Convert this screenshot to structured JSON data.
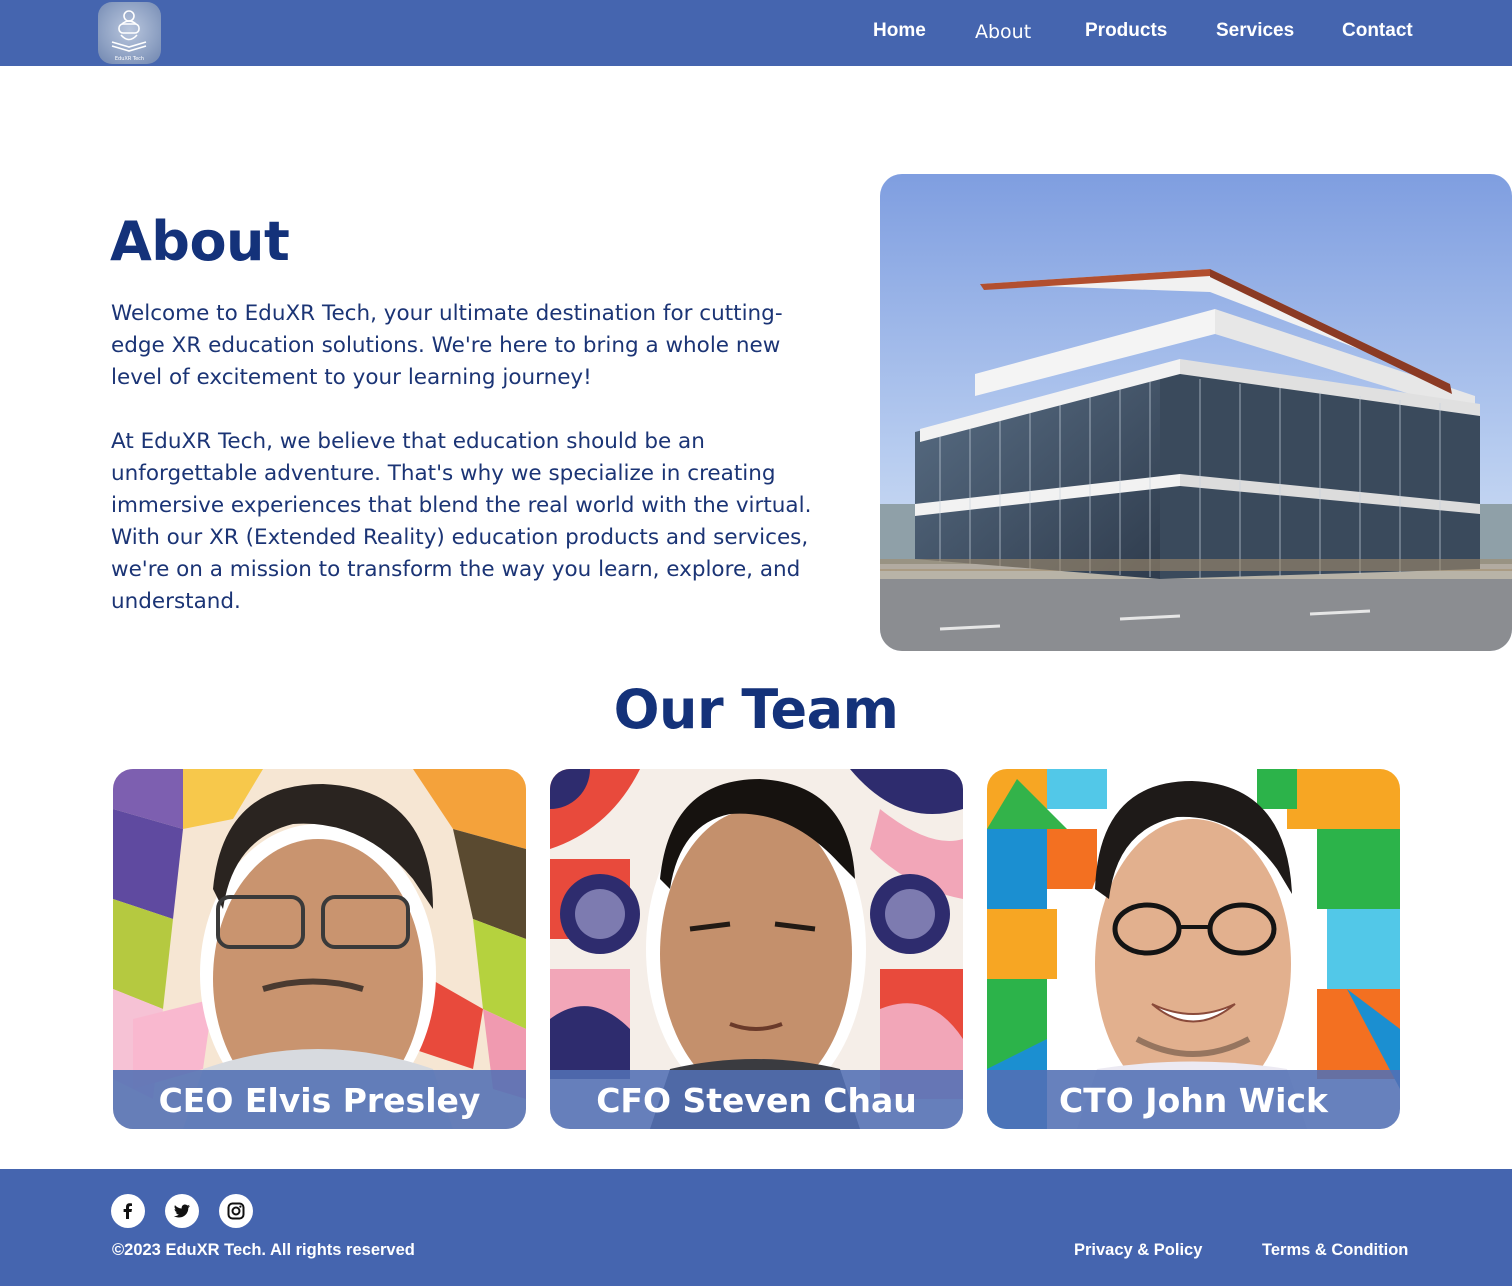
{
  "brand": {
    "logo_icon": "vr-headset-student-logo",
    "logo_text": "EduXR Tech",
    "nav_color": "#4565af",
    "title_color": "#14327a"
  },
  "nav": {
    "items": [
      {
        "label": "Home"
      },
      {
        "label": "About"
      },
      {
        "label": "Products"
      },
      {
        "label": "Services"
      },
      {
        "label": "Contact"
      }
    ],
    "active": "About"
  },
  "about": {
    "title": "About",
    "paragraph1": "Welcome to EduXR Tech, your ultimate destination for cutting-edge XR education solutions. We're here to bring a whole new level of excitement to your learning journey!",
    "paragraph2": "At EduXR Tech, we believe that education should be an unforgettable adventure. That's why we specialize in creating immersive experiences that blend the real world with the virtual. With our XR (Extended Reality) education products and services, we're on a mission to transform the way you learn, explore, and understand.",
    "image": "modern-office-building-photo"
  },
  "team": {
    "title": "Our Team",
    "members": [
      {
        "caption": "CEO Elvis Presley",
        "image": "portrait-photo"
      },
      {
        "caption": "CFO Steven Chau",
        "image": "portrait-photo"
      },
      {
        "caption": "CTO John Wick",
        "image": "portrait-photo"
      }
    ]
  },
  "footer": {
    "social": [
      {
        "icon": "facebook-icon"
      },
      {
        "icon": "twitter-icon"
      },
      {
        "icon": "instagram-icon"
      }
    ],
    "copyright": "©2023 EduXR Tech. All rights reserved",
    "links": [
      {
        "label": "Privacy & Policy"
      },
      {
        "label": "Terms & Condition"
      }
    ]
  }
}
